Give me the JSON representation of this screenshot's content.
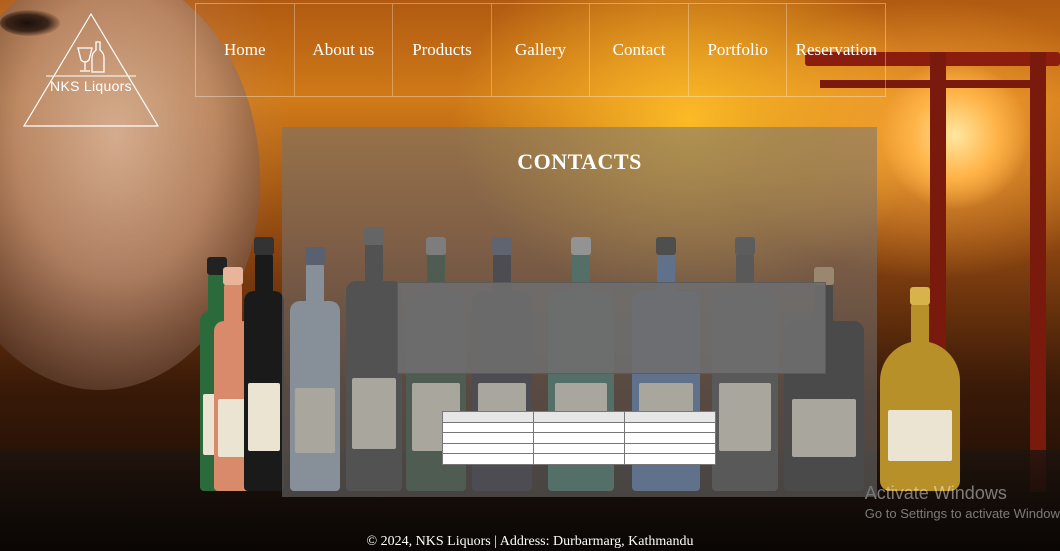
{
  "brand": {
    "name": "NKS Liquors",
    "logo_icon": "wine-glass-and-bottle"
  },
  "nav": {
    "items": [
      {
        "label": "Home"
      },
      {
        "label": "About us"
      },
      {
        "label": "Products"
      },
      {
        "label": "Gallery"
      },
      {
        "label": "Contact"
      },
      {
        "label": "Portfolio"
      },
      {
        "label": "Reservation"
      }
    ]
  },
  "contact": {
    "heading": "CONTACTS",
    "table_rows": 5,
    "table_cols": 3
  },
  "footer": {
    "text": "© 2024, NKS Liquors | Address: Durbarmarg, Kathmandu"
  },
  "watermark": {
    "line1": "Activate Windows",
    "line2": "Go to Settings to activate Windows."
  },
  "colors": {
    "nav_text": "#ffffff",
    "panel_overlay": "#737373",
    "accent_orange": "#d07a18"
  }
}
